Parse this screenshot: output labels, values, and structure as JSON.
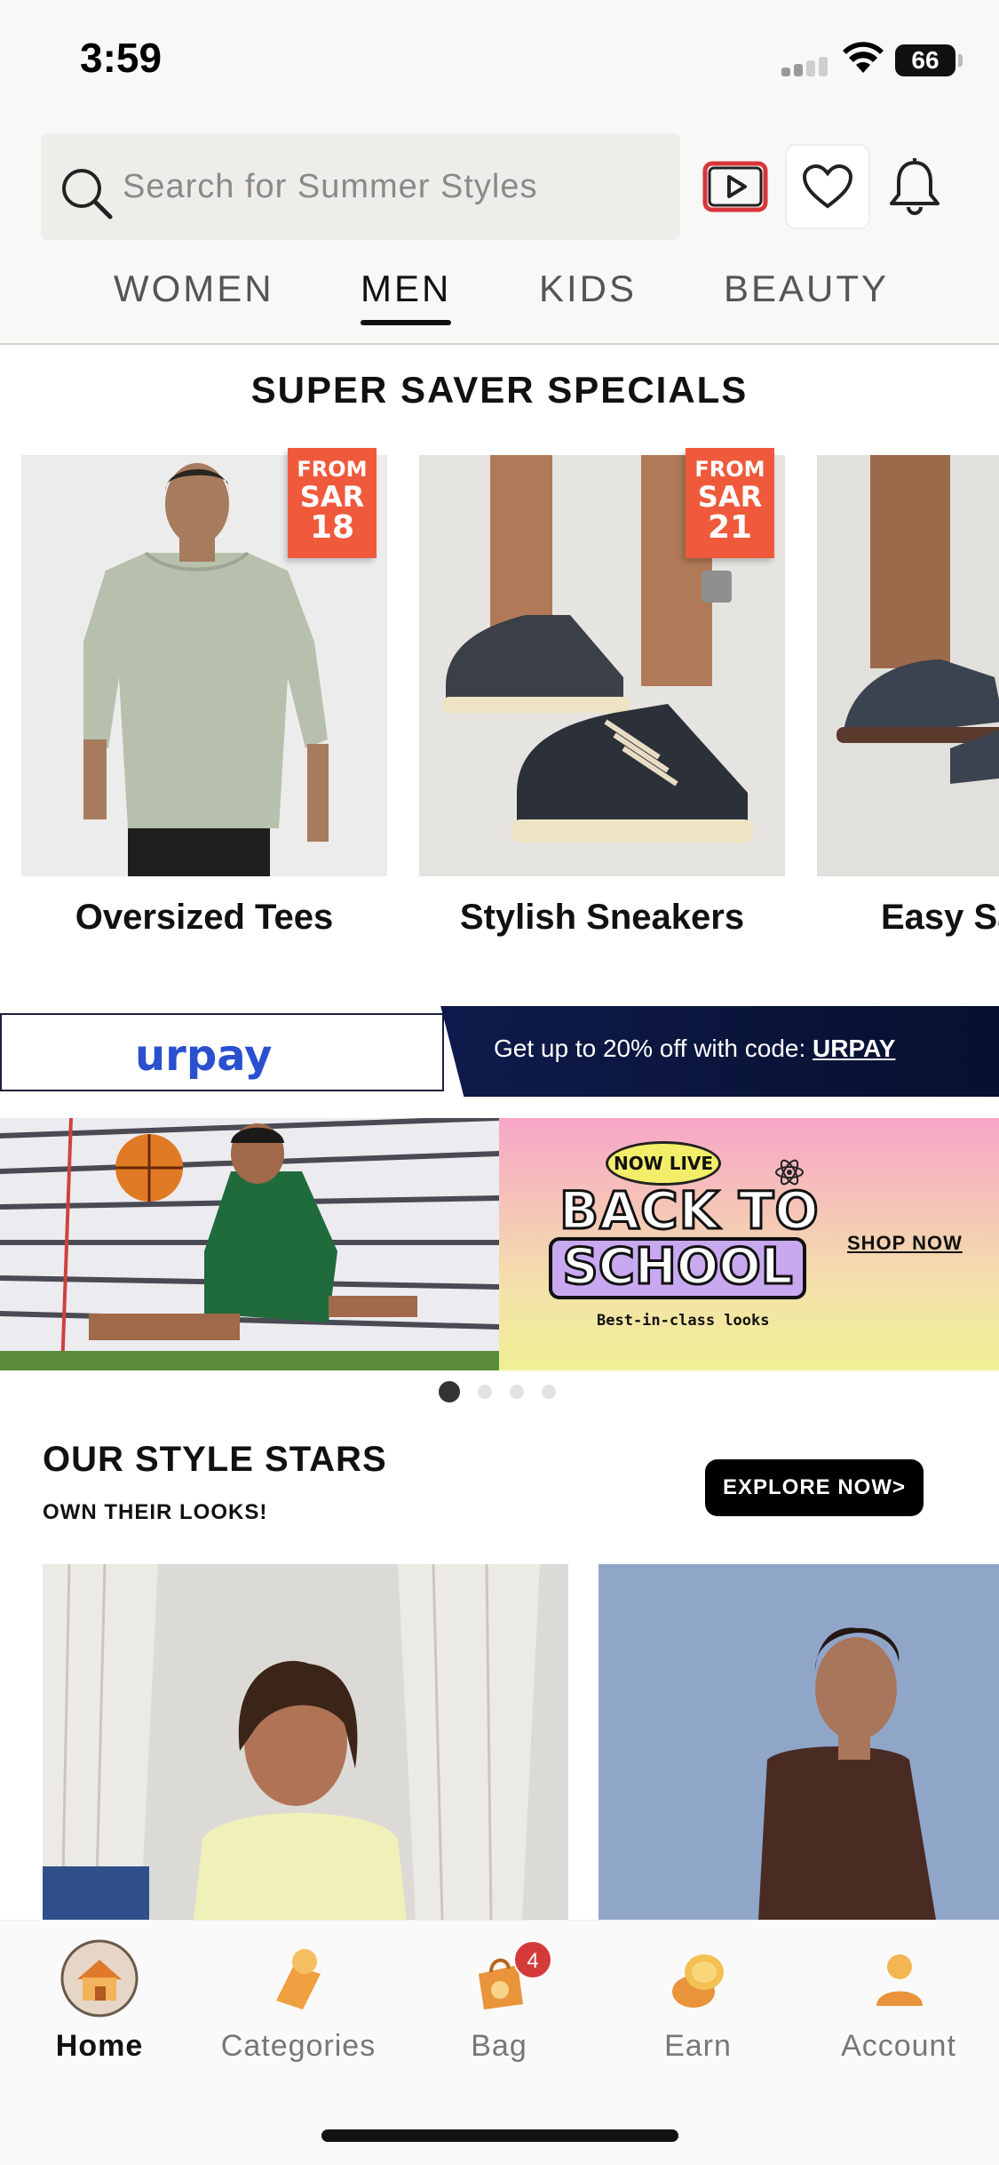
{
  "status_bar": {
    "time": "3:59",
    "battery": "66"
  },
  "header": {
    "search": {
      "placeholder": "Search for Summer Styles"
    },
    "icons": [
      "video-play-icon",
      "heart-icon",
      "bell-icon"
    ]
  },
  "tabs": [
    {
      "label": "WOMEN",
      "active": false
    },
    {
      "label": "MEN",
      "active": true
    },
    {
      "label": "KIDS",
      "active": false
    },
    {
      "label": "BEAUTY",
      "active": false
    }
  ],
  "super_saver": {
    "title": "SUPER SAVER SPECIALS",
    "items": [
      {
        "label": "Oversized Tees",
        "tag_from": "FROM",
        "tag_currency": "SAR",
        "tag_price": "18"
      },
      {
        "label": "Stylish Sneakers",
        "tag_from": "FROM",
        "tag_currency": "SAR",
        "tag_price": "21"
      },
      {
        "label": "Easy Sa"
      }
    ]
  },
  "urpay_banner": {
    "logo": "urpay",
    "text": "Get up to 20% off with code: ",
    "code": "URPAY"
  },
  "promo": {
    "badge": "NOW LIVE",
    "headline_1": "BACK TO",
    "headline_2": "SCHOOL",
    "subline": "Best-in-class looks",
    "cta": "SHOP NOW",
    "dots": 4,
    "active_dot": 0
  },
  "style_stars": {
    "title": "OUR STYLE STARS",
    "subtitle": "OWN THEIR LOOKS!",
    "cta": "EXPLORE NOW>"
  },
  "bottom_nav": [
    {
      "label": "Home",
      "icon": "home-icon",
      "active": true
    },
    {
      "label": "Categories",
      "icon": "categories-icon",
      "active": false
    },
    {
      "label": "Bag",
      "icon": "bag-icon",
      "active": false,
      "badge": "4"
    },
    {
      "label": "Earn",
      "icon": "coins-icon",
      "active": false
    },
    {
      "label": "Account",
      "icon": "account-icon",
      "active": false
    }
  ],
  "colors": {
    "accent_price_tag": "#ef5a3c",
    "urpay_blue": "#2a4fcf",
    "urpay_navy": "#0f1b4d",
    "badge_red": "#d43a3a"
  }
}
